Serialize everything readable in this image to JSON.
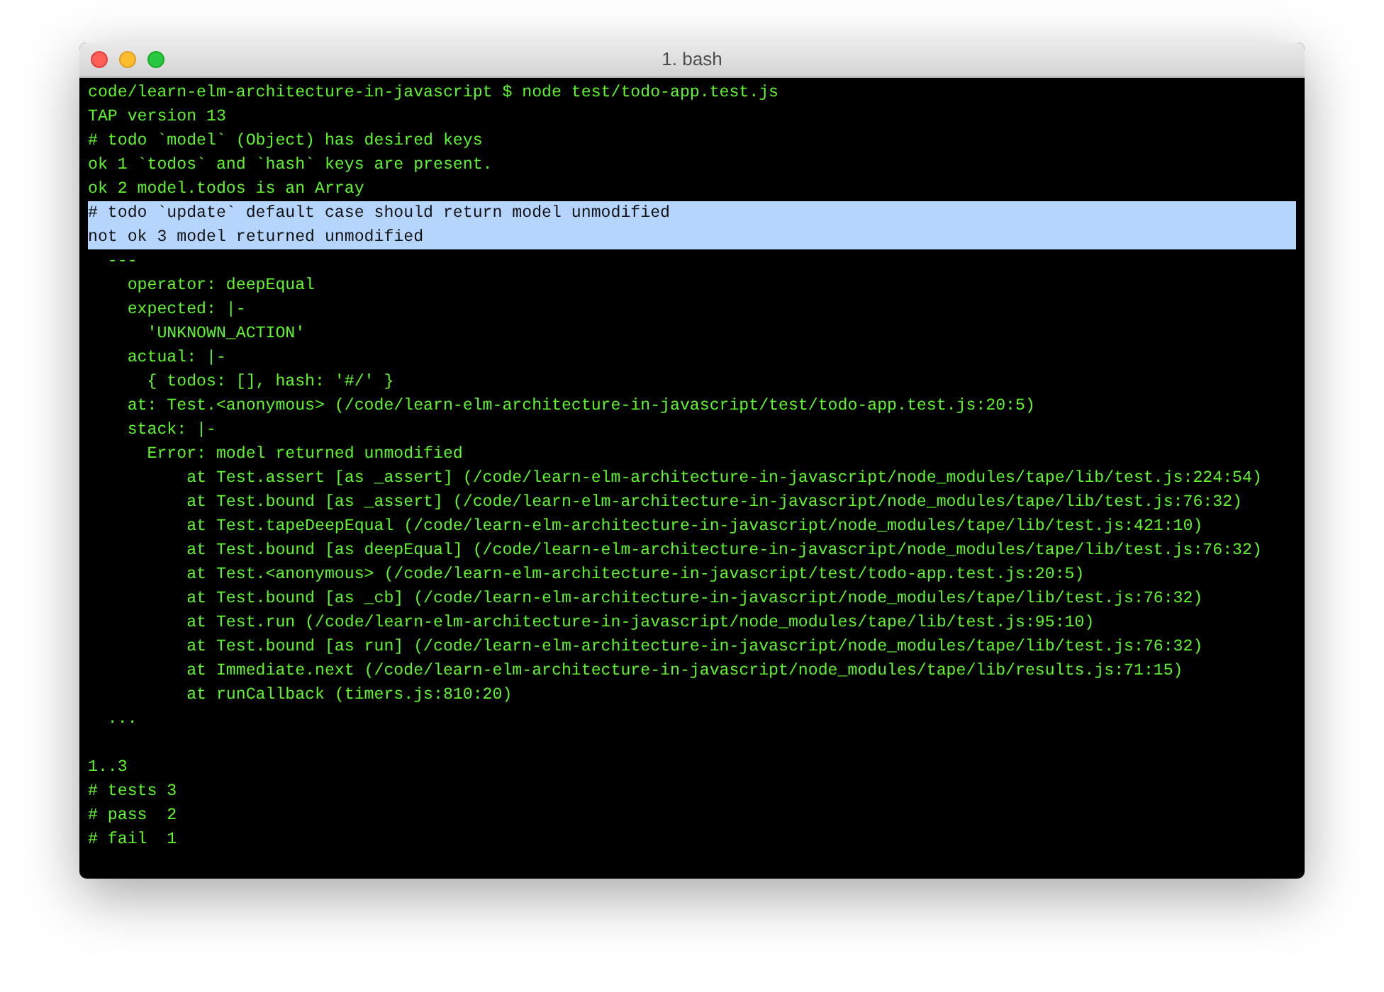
{
  "window": {
    "title": "1. bash"
  },
  "terminal": {
    "blocks": [
      {
        "lines": [
          {
            "text": "code/learn-elm-architecture-in-javascript $ node test/todo-app.test.js",
            "selected": false
          },
          {
            "text": "TAP version 13",
            "selected": false
          },
          {
            "text": "# todo `model` (Object) has desired keys",
            "selected": false
          },
          {
            "text": "ok 1 `todos` and `hash` keys are present.",
            "selected": false
          },
          {
            "text": "ok 2 model.todos is an Array",
            "selected": false
          },
          {
            "text": "# todo `update` default case should return model unmodified",
            "selected": true
          },
          {
            "text": "not ok 3 model returned unmodified",
            "selected": true
          },
          {
            "text": "  ---",
            "selected": false
          },
          {
            "text": "    operator: deepEqual",
            "selected": false
          },
          {
            "text": "    expected: |-",
            "selected": false
          },
          {
            "text": "      'UNKNOWN_ACTION'",
            "selected": false
          },
          {
            "text": "    actual: |-",
            "selected": false
          },
          {
            "text": "      { todos: [], hash: '#/' }",
            "selected": false
          },
          {
            "text": "    at: Test.<anonymous> (/code/learn-elm-architecture-in-javascript/test/todo-app.test.js:20:5)",
            "selected": false
          },
          {
            "text": "    stack: |-",
            "selected": false
          },
          {
            "text": "      Error: model returned unmodified",
            "selected": false
          },
          {
            "text": "          at Test.assert [as _assert] (/code/learn-elm-architecture-in-javascript/node_modules/tape/lib/test.js:224:54)",
            "selected": false
          },
          {
            "text": "          at Test.bound [as _assert] (/code/learn-elm-architecture-in-javascript/node_modules/tape/lib/test.js:76:32)",
            "selected": false
          },
          {
            "text": "          at Test.tapeDeepEqual (/code/learn-elm-architecture-in-javascript/node_modules/tape/lib/test.js:421:10)",
            "selected": false
          },
          {
            "text": "          at Test.bound [as deepEqual] (/code/learn-elm-architecture-in-javascript/node_modules/tape/lib/test.js:76:32)",
            "selected": false
          },
          {
            "text": "          at Test.<anonymous> (/code/learn-elm-architecture-in-javascript/test/todo-app.test.js:20:5)",
            "selected": false
          },
          {
            "text": "          at Test.bound [as _cb] (/code/learn-elm-architecture-in-javascript/node_modules/tape/lib/test.js:76:32)",
            "selected": false
          },
          {
            "text": "          at Test.run (/code/learn-elm-architecture-in-javascript/node_modules/tape/lib/test.js:95:10)",
            "selected": false
          },
          {
            "text": "          at Test.bound [as run] (/code/learn-elm-architecture-in-javascript/node_modules/tape/lib/test.js:76:32)",
            "selected": false
          },
          {
            "text": "          at Immediate.next (/code/learn-elm-architecture-in-javascript/node_modules/tape/lib/results.js:71:15)",
            "selected": false
          },
          {
            "text": "          at runCallback (timers.js:810:20)",
            "selected": false
          },
          {
            "text": "  ...",
            "selected": false
          }
        ]
      },
      {
        "lines": [
          {
            "text": "1..3",
            "selected": false
          },
          {
            "text": "# tests 3",
            "selected": false
          },
          {
            "text": "# pass  2",
            "selected": false
          },
          {
            "text": "# fail  1",
            "selected": false
          }
        ]
      }
    ]
  }
}
